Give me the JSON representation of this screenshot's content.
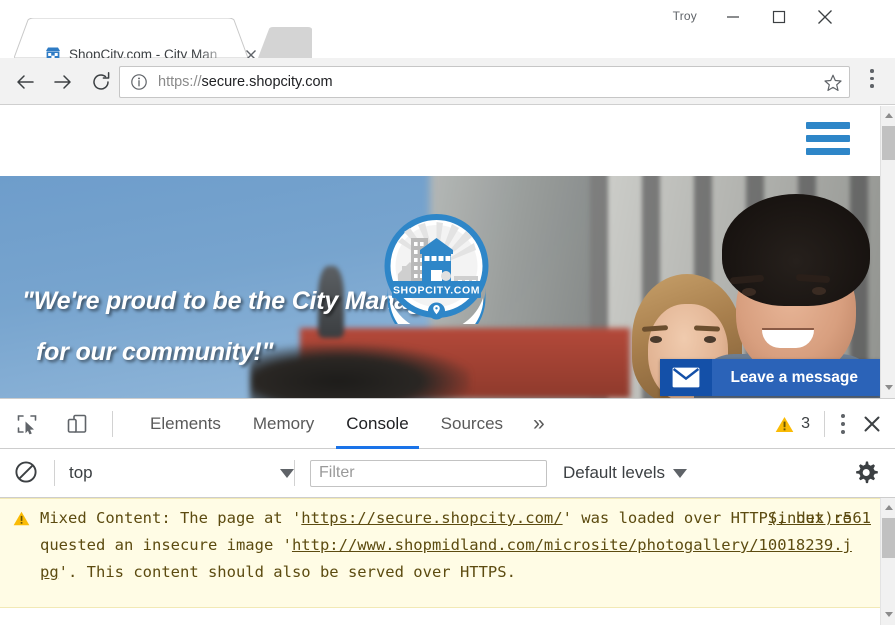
{
  "window": {
    "profile_name": "Troy",
    "minimize_label": "Minimize",
    "maximize_label": "Maximize",
    "close_label": "Close"
  },
  "browser": {
    "tab": {
      "title": "ShopCity.com - City Man",
      "favicon": "storefront-icon",
      "close_label": "×"
    },
    "toolbar": {
      "back": "back-arrow-icon",
      "forward": "forward-arrow-icon",
      "reload": "reload-icon",
      "info_icon": "info-circle-icon",
      "url_scheme": "https://",
      "url_host": "secure.shopcity.com",
      "url_full": "https://secure.shopcity.com",
      "star": "bookmark-star-icon",
      "menu": "chrome-menu-icon"
    }
  },
  "page": {
    "logo": {
      "wordmark": "SHOPCITY.COM"
    },
    "menu_icon": "hamburger-icon",
    "hero": {
      "quote_line1": "\"We're proud to be the City Managers",
      "quote_line2": "for our community!\""
    },
    "chat": {
      "label": "Leave a message",
      "icon": "envelope-icon"
    }
  },
  "devtools": {
    "inspect_icon": "inspect-element-icon",
    "device_icon": "device-toolbar-icon",
    "tabs": [
      {
        "label": "Elements",
        "active": false
      },
      {
        "label": "Memory",
        "active": false
      },
      {
        "label": "Console",
        "active": true
      },
      {
        "label": "Sources",
        "active": false
      }
    ],
    "more_tabs": "»",
    "warning_count": "3",
    "warning_icon": "warning-triangle-icon",
    "kebab_label": "more-options",
    "close_label": "close-devtools",
    "accent_color": "#1a73e8",
    "warning_color": "#fabb05"
  },
  "console": {
    "clear_icon": "clear-console-icon",
    "context": "top",
    "context_caret": "▼",
    "filter_placeholder": "Filter",
    "filter_value": "",
    "levels": "Default levels",
    "levels_caret": "▼",
    "settings_icon": "gear-icon",
    "message": {
      "severity": "warning",
      "part1": "Mixed Content: The page at '",
      "link1": "https://secure.shopcity.com/",
      "part2": "' was loaded over HTTPS, but requested an insecure image '",
      "link2": "http://www.shopmidland.com/microsite/photogallery/10018239.jpg",
      "part3": "'. This content should also be served over HTTPS.",
      "source": "(index):561",
      "background_color": "#fffce5",
      "text_color": "#5c4b10"
    }
  }
}
